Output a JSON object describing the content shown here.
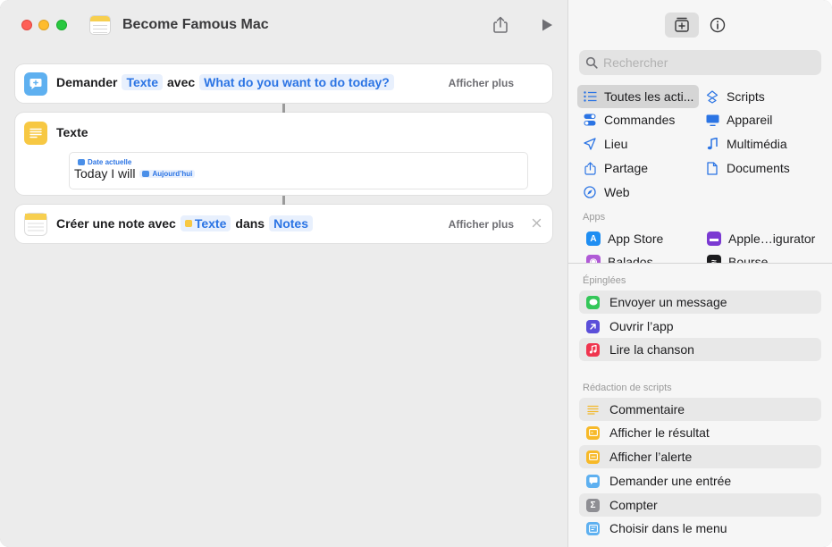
{
  "window": {
    "title": "Become Famous Mac"
  },
  "workflow": {
    "ask_card": {
      "verb": "Demander",
      "type_token": "Texte",
      "connector": "avec",
      "prompt_token": "What do you want to do today?",
      "show_more": "Afficher plus"
    },
    "text_card": {
      "title": "Texte",
      "variable_label": "Date actuelle",
      "body_text": "Today I will",
      "variable_token": "Aujourd’hui"
    },
    "note_card": {
      "verb": "Créer une note avec",
      "input_token": "Texte",
      "connector": "dans",
      "app_token": "Notes",
      "show_more": "Afficher plus"
    }
  },
  "sidebar": {
    "search_placeholder": "Rechercher",
    "categories": [
      {
        "label": "Toutes les acti...",
        "icon": "list-icon",
        "selected": true
      },
      {
        "label": "Scripts",
        "icon": "scripts-icon"
      },
      {
        "label": "Commandes",
        "icon": "toggles-icon"
      },
      {
        "label": "Appareil",
        "icon": "display-icon"
      },
      {
        "label": "Lieu",
        "icon": "location-arrow-icon"
      },
      {
        "label": "Multimédia",
        "icon": "music-note-icon"
      },
      {
        "label": "Partage",
        "icon": "share-icon"
      },
      {
        "label": "Documents",
        "icon": "document-icon"
      },
      {
        "label": "Web",
        "icon": "compass-icon"
      }
    ],
    "apps_label": "Apps",
    "apps": [
      {
        "label": "App Store",
        "icon": "app-store-icon"
      },
      {
        "label": "Apple…igurator",
        "icon": "apple-configurator-icon"
      },
      {
        "label": "Balados",
        "icon": "podcasts-icon"
      },
      {
        "label": "Bourse",
        "icon": "stocks-icon"
      }
    ],
    "pinned_label": "Épinglées",
    "pinned": [
      {
        "label": "Envoyer un message",
        "icon": "messages-icon"
      },
      {
        "label": "Ouvrir l’app",
        "icon": "open-app-icon"
      },
      {
        "label": "Lire la chanson",
        "icon": "music-icon"
      }
    ],
    "scripting_label": "Rédaction de scripts",
    "scripting": [
      {
        "label": "Commentaire",
        "icon": "comment-icon"
      },
      {
        "label": "Afficher le résultat",
        "icon": "show-result-icon"
      },
      {
        "label": "Afficher l’alerte",
        "icon": "alert-icon"
      },
      {
        "label": "Demander une entrée",
        "icon": "ask-input-icon"
      },
      {
        "label": "Compter",
        "icon": "count-icon"
      },
      {
        "label": "Choisir dans le menu",
        "icon": "menu-icon"
      }
    ]
  },
  "colors": {
    "accent_blue": "#2b74e4",
    "token_bg": "#e8f0fd",
    "notes_yellow": "#f7cf4f",
    "ask_icon_blue": "#5eb0f0"
  }
}
